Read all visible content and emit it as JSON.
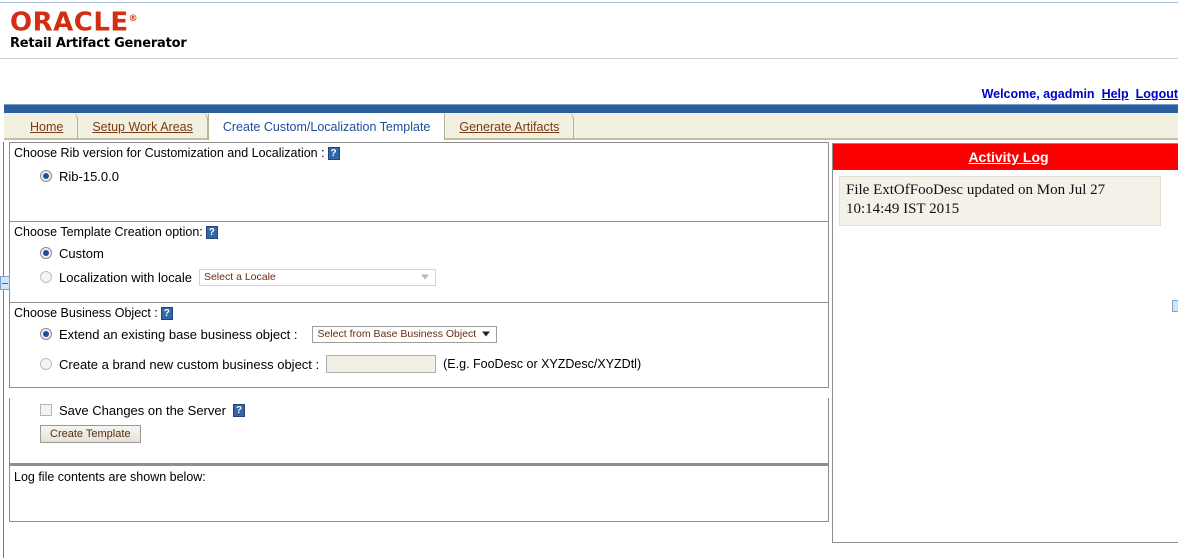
{
  "branding": {
    "logo_text": "ORACLE",
    "logo_color": "#d42e12",
    "product_name": "Retail Artifact Generator"
  },
  "userbar": {
    "welcome": "Welcome, agadmin",
    "help": "Help",
    "logout": "Logout",
    "link_color": "#0000cc"
  },
  "tabs": [
    {
      "label": "Home",
      "active": false
    },
    {
      "label": "Setup Work Areas",
      "active": false
    },
    {
      "label": "Create Custom/Localization Template",
      "active": true
    },
    {
      "label": "Generate Artifacts",
      "active": false
    }
  ],
  "sections": {
    "rib_version": {
      "label": "Choose Rib version for Customization and Localization :",
      "help_icon": "help-question-icon",
      "option_label": "Rib-15.0.0",
      "option_selected": true
    },
    "template_creation": {
      "label": "Choose Template Creation option:",
      "help_icon": "help-question-icon",
      "custom_label": "Custom",
      "custom_selected": true,
      "localization_label": "Localization with locale",
      "localization_selected": false,
      "locale_select_value": "Select a Locale",
      "locale_select_enabled": false
    },
    "business_object": {
      "label": "Choose Business Object :",
      "help_icon": "help-question-icon",
      "extend_label": "Extend an existing base business object :",
      "extend_selected": true,
      "extend_select_value": "Select from Base Business Object",
      "create_label": "Create a brand new custom business object :",
      "create_selected": false,
      "create_input_value": "",
      "create_hint": "(E.g. FooDesc or XYZDesc/XYZDtl)"
    },
    "save_section": {
      "save_label": "Save Changes on the Server",
      "save_checked": false,
      "help_icon": "help-question-icon",
      "button_label": "Create Template"
    },
    "log_file": {
      "label": "Log file contents are shown below:"
    }
  },
  "activity_log": {
    "title": "Activity Log",
    "header_color": "#fb0000",
    "entries": [
      "File ExtOfFooDesc updated on Mon Jul 27 10:14:49 IST 2015"
    ]
  }
}
